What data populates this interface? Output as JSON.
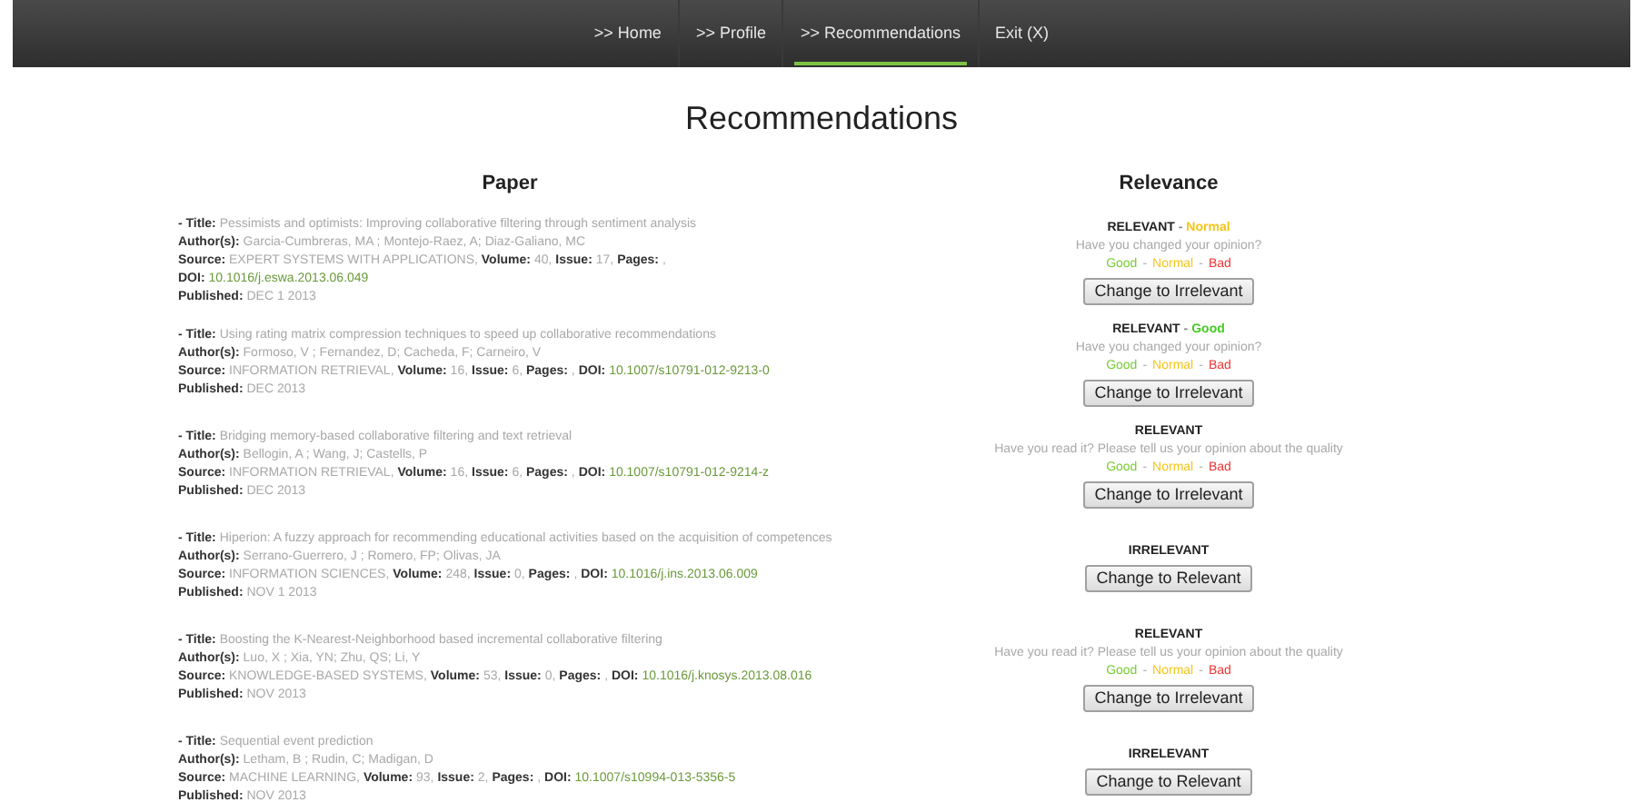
{
  "nav": {
    "items": [
      {
        "label": ">> Home",
        "selected": false
      },
      {
        "label": ">> Profile",
        "selected": false
      },
      {
        "label": ">> Recommendations",
        "selected": true
      },
      {
        "label": "Exit (X)",
        "selected": false
      }
    ]
  },
  "page_title": "Recommendations",
  "columns": [
    "Paper",
    "Relevance"
  ],
  "rows": [
    {
      "paper": {
        "source_separator": ",",
        "title": {
          "label": "- Title:",
          "value": "Pessimists and optimists: Improving collaborative filtering through sentiment analysis"
        },
        "authors": {
          "label": "Author(s):",
          "value": "Garcia-Cumbreras, MA ; Montejo-Raez, A; Diaz-Galiano, MC"
        },
        "source": [
          {
            "label": "Source:",
            "value": "EXPERT SYSTEMS WITH APPLICATIONS",
            "kind": "plain"
          },
          {
            "label": "Volume:",
            "value": "40",
            "kind": "plain"
          },
          {
            "label": "Issue:",
            "value": "17",
            "kind": "plain"
          },
          {
            "label": "Pages:",
            "kind": "plain"
          },
          {
            "label": "DOI:",
            "value": "10.1016/j.eswa.2013.06.049",
            "kind": "doi"
          }
        ],
        "published": {
          "label": "Published:",
          "value": "DEC 1 2013"
        }
      },
      "relevance": {
        "status": "RELEVANT",
        "rating": {
          "separator": "-",
          "label": "Normal",
          "color": "#f5c518"
        },
        "question": "Have you changed your opinion?",
        "options": [
          {
            "label": "Good",
            "color": "#77cc33"
          },
          {
            "label": "Normal",
            "color": "#f5c518"
          },
          {
            "label": "Bad",
            "color": "#ee3333"
          }
        ],
        "separator": "-",
        "button": "Change to Irrelevant"
      }
    },
    {
      "paper": {
        "source_separator": ",",
        "title": {
          "label": "- Title:",
          "value": "Using rating matrix compression techniques to speed up collaborative recommendations"
        },
        "authors": {
          "label": "Author(s):",
          "value": "Formoso, V ; Fernandez, D; Cacheda, F; Carneiro, V"
        },
        "source": [
          {
            "label": "Source:",
            "value": "INFORMATION RETRIEVAL",
            "kind": "plain"
          },
          {
            "label": "Volume:",
            "value": "16",
            "kind": "plain"
          },
          {
            "label": "Issue:",
            "value": "6",
            "kind": "plain"
          },
          {
            "label": "Pages:",
            "kind": "plain"
          },
          {
            "label": "DOI:",
            "value": "10.1007/s10791-012-9213-0",
            "kind": "doi"
          }
        ],
        "published": {
          "label": "Published:",
          "value": "DEC 2013"
        }
      },
      "relevance": {
        "status": "RELEVANT",
        "rating": {
          "separator": "-",
          "label": "Good",
          "color": "#44cc22"
        },
        "question": "Have you changed your opinion?",
        "options": [
          {
            "label": "Good",
            "color": "#77cc33"
          },
          {
            "label": "Normal",
            "color": "#f5c518"
          },
          {
            "label": "Bad",
            "color": "#ee3333"
          }
        ],
        "separator": "-",
        "button": "Change to Irrelevant"
      }
    },
    {
      "paper": {
        "source_separator": ",",
        "title": {
          "label": "- Title:",
          "value": "Bridging memory-based collaborative filtering and text retrieval"
        },
        "authors": {
          "label": "Author(s):",
          "value": "Bellogin, A ; Wang, J; Castells, P"
        },
        "source": [
          {
            "label": "Source:",
            "value": "INFORMATION RETRIEVAL",
            "kind": "plain"
          },
          {
            "label": "Volume:",
            "value": "16",
            "kind": "plain"
          },
          {
            "label": "Issue:",
            "value": "6",
            "kind": "plain"
          },
          {
            "label": "Pages:",
            "kind": "plain"
          },
          {
            "label": "DOI:",
            "value": "10.1007/s10791-012-9214-z",
            "kind": "doi"
          }
        ],
        "published": {
          "label": "Published:",
          "value": "DEC 2013"
        }
      },
      "relevance": {
        "status": "RELEVANT",
        "question": "Have you read it? Please tell us your opinion about the quality",
        "options": [
          {
            "label": "Good",
            "color": "#77cc33"
          },
          {
            "label": "Normal",
            "color": "#f5c518"
          },
          {
            "label": "Bad",
            "color": "#ee3333"
          }
        ],
        "separator": "-",
        "button": "Change to Irrelevant"
      }
    },
    {
      "paper": {
        "source_separator": ",",
        "title": {
          "label": "- Title:",
          "value": "Hiperion: A fuzzy approach for recommending educational activities based on the acquisition of competences"
        },
        "authors": {
          "label": "Author(s):",
          "value": "Serrano-Guerrero, J ; Romero, FP; Olivas, JA"
        },
        "source": [
          {
            "label": "Source:",
            "value": "INFORMATION SCIENCES",
            "kind": "plain"
          },
          {
            "label": "Volume:",
            "value": "248",
            "kind": "plain"
          },
          {
            "label": "Issue:",
            "value": "0",
            "kind": "plain"
          },
          {
            "label": "Pages:",
            "kind": "plain"
          },
          {
            "label": "DOI:",
            "value": "10.1016/j.ins.2013.06.009",
            "kind": "doi"
          }
        ],
        "published": {
          "label": "Published:",
          "value": "NOV 1 2013"
        }
      },
      "relevance": {
        "status": "IRRELEVANT",
        "button": "Change to Relevant"
      }
    },
    {
      "paper": {
        "source_separator": ",",
        "title": {
          "label": "- Title:",
          "value": "Boosting the K-Nearest-Neighborhood based incremental collaborative filtering"
        },
        "authors": {
          "label": "Author(s):",
          "value": "Luo, X ; Xia, YN; Zhu, QS; Li, Y"
        },
        "source": [
          {
            "label": "Source:",
            "value": "KNOWLEDGE-BASED SYSTEMS",
            "kind": "plain"
          },
          {
            "label": "Volume:",
            "value": "53",
            "kind": "plain"
          },
          {
            "label": "Issue:",
            "value": "0",
            "kind": "plain"
          },
          {
            "label": "Pages:",
            "kind": "plain"
          },
          {
            "label": "DOI:",
            "value": "10.1016/j.knosys.2013.08.016",
            "kind": "doi"
          }
        ],
        "published": {
          "label": "Published:",
          "value": "NOV 2013"
        }
      },
      "relevance": {
        "status": "RELEVANT",
        "question": "Have you read it? Please tell us your opinion about the quality",
        "options": [
          {
            "label": "Good",
            "color": "#77cc33"
          },
          {
            "label": "Normal",
            "color": "#f5c518"
          },
          {
            "label": "Bad",
            "color": "#ee3333"
          }
        ],
        "separator": "-",
        "button": "Change to Irrelevant"
      }
    },
    {
      "paper": {
        "source_separator": ",",
        "title": {
          "label": "- Title:",
          "value": "Sequential event prediction"
        },
        "authors": {
          "label": "Author(s):",
          "value": "Letham, B ; Rudin, C; Madigan, D"
        },
        "source": [
          {
            "label": "Source:",
            "value": "MACHINE LEARNING",
            "kind": "plain"
          },
          {
            "label": "Volume:",
            "value": "93",
            "kind": "plain"
          },
          {
            "label": "Issue:",
            "value": "2",
            "kind": "plain"
          },
          {
            "label": "Pages:",
            "kind": "plain"
          },
          {
            "label": "DOI:",
            "value": "10.1007/s10994-013-5356-5",
            "kind": "doi"
          }
        ],
        "published": {
          "label": "Published:",
          "value": "NOV 2013"
        }
      },
      "relevance": {
        "status": "IRRELEVANT",
        "button": "Change to Relevant"
      }
    }
  ]
}
